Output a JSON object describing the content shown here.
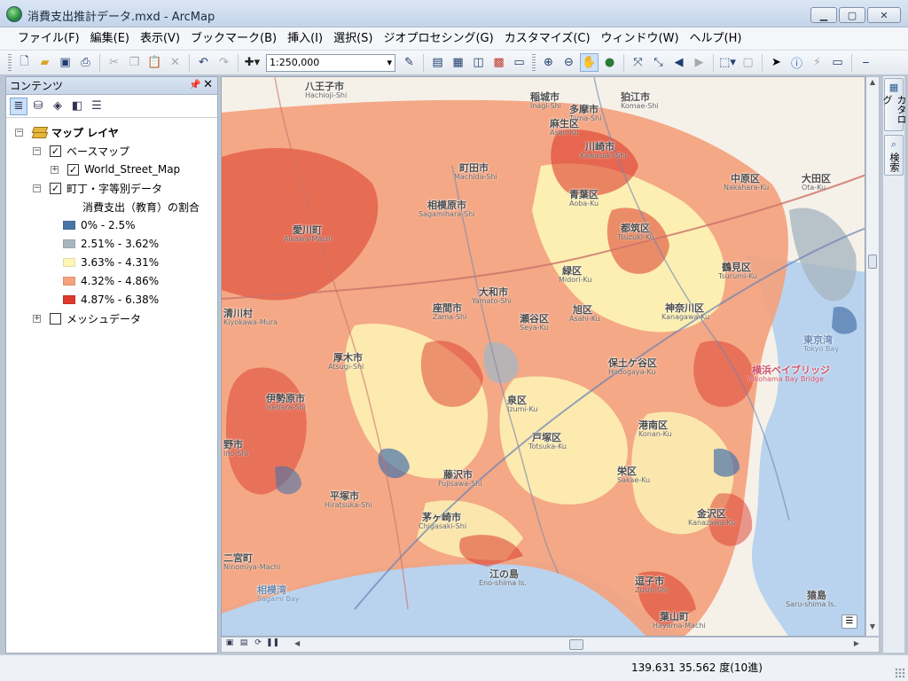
{
  "window": {
    "title": "消費支出推計データ.mxd - ArcMap",
    "min_icon": "minimize-icon",
    "max_icon": "maximize-icon",
    "close_icon": "close-icon"
  },
  "menu": [
    "ファイル(F)",
    "編集(E)",
    "表示(V)",
    "ブックマーク(B)",
    "挿入(I)",
    "選択(S)",
    "ジオプロセシング(G)",
    "カスタマイズ(C)",
    "ウィンドウ(W)",
    "ヘルプ(H)"
  ],
  "toolbar": {
    "scale": "1:250,000"
  },
  "toc": {
    "title": "コンテンツ",
    "root": "マップ レイヤ",
    "basemap_group": "ベースマップ",
    "basemap_layer": "World_Street_Map",
    "data_layer": "町丁・字等別データ",
    "legend_field": "消費支出（教育）の割合",
    "legend": [
      {
        "label": "0% - 2.5%",
        "color": "#4a73a8"
      },
      {
        "label": "2.51% - 3.62%",
        "color": "#a9b6c0"
      },
      {
        "label": "3.63% - 4.31%",
        "color": "#fdf6b6"
      },
      {
        "label": "4.32% - 4.86%",
        "color": "#f3a27d"
      },
      {
        "label": "4.87% - 6.38%",
        "color": "#dc3a2c"
      }
    ],
    "mesh_layer": "メッシュデータ"
  },
  "map": {
    "labels": [
      {
        "name": "八王子市",
        "sub": "Hachioji-Shi"
      },
      {
        "name": "多摩市",
        "sub": "Tama-Shi"
      },
      {
        "name": "稲城市",
        "sub": "Inagi-Shi"
      },
      {
        "name": "狛江市",
        "sub": "Komae-Shi"
      },
      {
        "name": "麻生区",
        "sub": "Asao-Ku"
      },
      {
        "name": "川崎市",
        "sub": "Kawasaki-Shi"
      },
      {
        "name": "町田市",
        "sub": "Machida-Shi"
      },
      {
        "name": "相模原市",
        "sub": "Sagamihara-Shi"
      },
      {
        "name": "青葉区",
        "sub": "Aoba-Ku"
      },
      {
        "name": "都筑区",
        "sub": "Tsuzuki-Ku"
      },
      {
        "name": "中原区",
        "sub": "Nakahara-Ku"
      },
      {
        "name": "大田区",
        "sub": "Ota-Ku"
      },
      {
        "name": "愛川町",
        "sub": "Aikawa-Machi"
      },
      {
        "name": "厚木市",
        "sub": "Atsugi-Shi"
      },
      {
        "name": "大和市",
        "sub": "Yamato-Shi"
      },
      {
        "name": "座間市",
        "sub": "Zama-Shi"
      },
      {
        "name": "瀬谷区",
        "sub": "Seya-Ku"
      },
      {
        "name": "緑区",
        "sub": "Midori-Ku"
      },
      {
        "name": "旭区",
        "sub": "Asahi-Ku"
      },
      {
        "name": "鶴見区",
        "sub": "Tsurumi-Ku"
      },
      {
        "name": "神奈川区",
        "sub": "Kanagawa-Ku"
      },
      {
        "name": "清川村",
        "sub": "Kiyokawa-Mura"
      },
      {
        "name": "保土ケ谷区",
        "sub": "Hodogaya-Ku"
      },
      {
        "name": "伊勢原市",
        "sub": "Isehara-Shi"
      },
      {
        "name": "泉区",
        "sub": "Izumi-Ku"
      },
      {
        "name": "戸塚区",
        "sub": "Totsuka-Ku"
      },
      {
        "name": "港南区",
        "sub": "Konan-Ku"
      },
      {
        "name": "藤沢市",
        "sub": "Fujisawa-Shi"
      },
      {
        "name": "平塚市",
        "sub": "Hiratsuka-Shi"
      },
      {
        "name": "茅ヶ崎市",
        "sub": "Chigasaki-Shi"
      },
      {
        "name": "栄区",
        "sub": "Sakae-Ku"
      },
      {
        "name": "金沢区",
        "sub": "Kanazawa-Ku"
      },
      {
        "name": "逗子市",
        "sub": "Zushi-Shi"
      },
      {
        "name": "葉山町",
        "sub": "Hayama-Machi"
      },
      {
        "name": "江の島",
        "sub": "Eno-shima Is."
      },
      {
        "name": "猿島",
        "sub": "Saru-shima Is."
      },
      {
        "name": "横浜ベイブリッジ",
        "sub": "Yokohama Bay Bridge"
      },
      {
        "name": "野市",
        "sub": "Ino-Shi"
      },
      {
        "name": "二宮町",
        "sub": "Ninomiya-Machi"
      },
      {
        "name": "相模湾",
        "sub": "Sagami Bay"
      },
      {
        "name": "東京湾",
        "sub": "Tokyo Bay"
      }
    ]
  },
  "side_tabs": [
    "カタログ",
    "検索"
  ],
  "status": {
    "coords": "139.631  35.562 度(10進)"
  }
}
